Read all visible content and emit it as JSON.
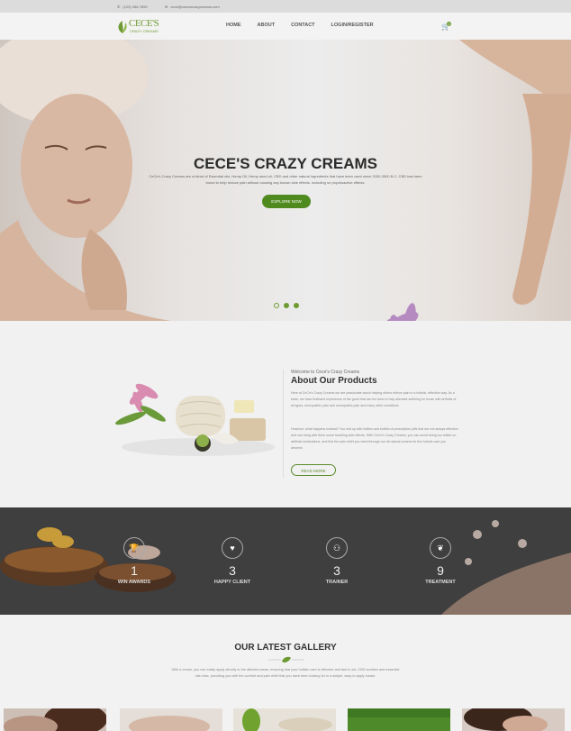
{
  "topbar": {
    "phone": "(123) 456-7890",
    "email": "cece@cecescrazycreams.com"
  },
  "logo": {
    "brand": "CECE'S",
    "tagline": "CRAZY CREAMS"
  },
  "nav": {
    "items": [
      "HOME",
      "ABOUT",
      "CONTACT",
      "LOGIN/REGISTER"
    ]
  },
  "cart": {
    "count": "0"
  },
  "hero": {
    "title": "CECE'S CRAZY CREAMS",
    "description": "CeCe's Crazy Creams are a blend of Essential oils, Hemp Oil, Hemp seed oil, CBD and other natural ingredients that have been used since 2000-3500 B.C. CBD has been found to help reduce pain without causing any known side effects, including no psychoactive effects.",
    "button_label": "EXPLORE NOW",
    "slides": 3,
    "active_slide": 1
  },
  "about": {
    "kicker": "Welcome to Cece's Crazy Creams",
    "title": "About Our Products",
    "paragraph1": "Here at CeCe's Crazy Creams we are passionate about helping others relieve pain in a holistic, effective way. As a team, we have firsthand experience of the good that can be done to help alleviate suffering for those with arthritis of all types, neuropathic pain and neuropathic pain and many other conditions.",
    "paragraph2": "However, what happens instead? You end up with bottles and bottles of prescription pills that are not always effective and can bring with them some troubling side effects. With CeCe's Crazy Creams, you can avoid being too reliant on artificial medications, and find the pain relief you need through our all natural creams for the holistic care you deserve.",
    "button_label": "READ MORE"
  },
  "stats": [
    {
      "icon": "trophy-icon",
      "glyph": "🏆",
      "value": "1",
      "label": "WIN AWARDS"
    },
    {
      "icon": "heart-icon",
      "glyph": "♥",
      "value": "3",
      "label": "HAPPY CLIENT"
    },
    {
      "icon": "trainer-icon",
      "glyph": "⚇",
      "value": "3",
      "label": "TRAINER"
    },
    {
      "icon": "treatment-icon",
      "glyph": "❦",
      "value": "9",
      "label": "TREATMENT"
    }
  ],
  "gallery": {
    "title": "OUR LATEST GALLERY",
    "description": "With a cream, you can easily apply directly to the affected areas, ensuring that your holistic care is effective and fast to act. CBD soothes and essential oils relax, providing you with the comfort and pain relief that you have been looking for in a simple, easy to apply cream."
  },
  "colors": {
    "accent": "#4f8a1f",
    "accent_light": "#6e9a33",
    "dark_band": "#3f3f3f"
  }
}
